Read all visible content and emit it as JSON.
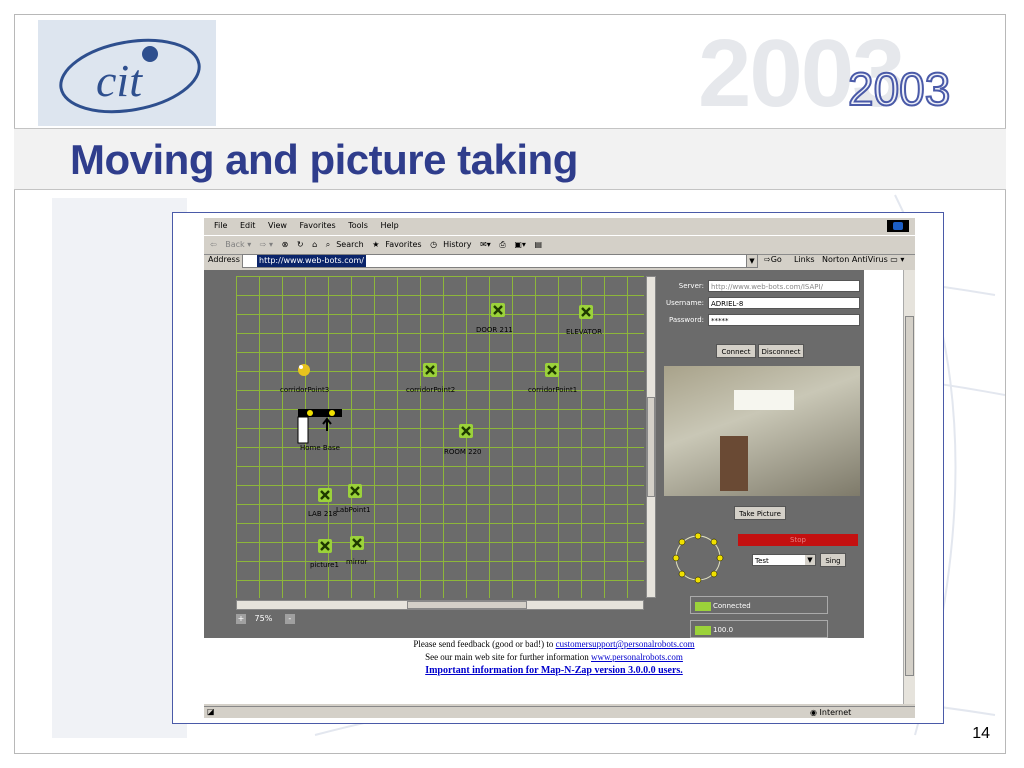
{
  "slide": {
    "title": "Moving and picture taking",
    "year_large": "2003",
    "year_small": "2003",
    "page_number": "14",
    "logo_text": "cit"
  },
  "browser": {
    "menu": [
      "File",
      "Edit",
      "View",
      "Favorites",
      "Tools",
      "Help"
    ],
    "toolbar": {
      "back": "Back",
      "search": "Search",
      "favorites": "Favorites",
      "history": "History"
    },
    "address_label": "Address",
    "address_value": "http://www.web-bots.com/",
    "go_label": "Go",
    "links_label": "Links",
    "norton_label": "Norton AntiVirus",
    "status_zone": "Internet"
  },
  "map": {
    "zoom_level": "75%",
    "zoom_in": "+",
    "zoom_out": "-",
    "points": {
      "door211": "DOOR 211",
      "elevator": "ELEVATOR",
      "corridor3": "corridorPoint3",
      "corridor2": "corridorPoint2",
      "corridor1": "corridorPoint1",
      "homebase": "Home Base",
      "room220": "ROOM 220",
      "lab218": "LAB 218",
      "labpoint1": "LabPoint1",
      "picture1": "picture1",
      "mirror": "mirror"
    }
  },
  "controls": {
    "server_label": "Server:",
    "server_value": "http://www.web-bots.com/ISAPI/",
    "username_label": "Username:",
    "username_value": "ADRIEL-8",
    "password_label": "Password:",
    "password_value": "*****",
    "connect": "Connect",
    "disconnect": "Disconnect",
    "take_picture": "Take Picture",
    "stop": "Stop",
    "test_select": "Test",
    "sing": "Sing",
    "connected": "Connected",
    "battery": "100.0"
  },
  "footer": {
    "line1_prefix": "Please send feedback (good or bad!) to ",
    "line1_link": "customersupport@personalrobots.com",
    "line2_prefix": "See our main web site for further information ",
    "line2_link": "www.personalrobots.com",
    "line3_link": "Important information for Map-N-Zap version 3.0.0.0 users."
  },
  "colors": {
    "title": "#2f3d8c",
    "grid": "#8db63a",
    "marker": "#9bd23a",
    "stop": "#c41010"
  }
}
